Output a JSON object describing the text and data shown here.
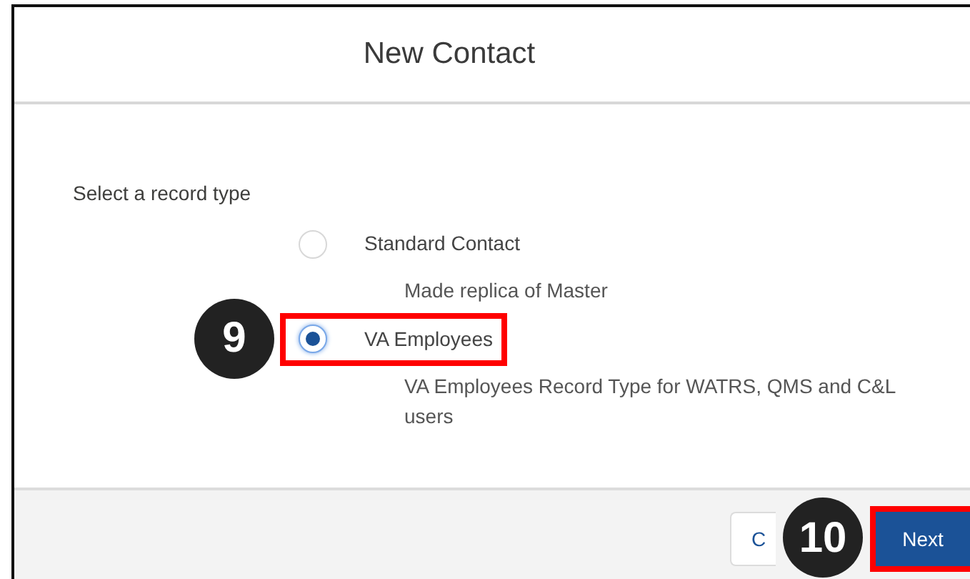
{
  "modal": {
    "title": "New Contact"
  },
  "prompt": "Select a record type",
  "options": [
    {
      "label": "Standard Contact",
      "description": "Made replica of Master",
      "selected": false,
      "highlighted": false
    },
    {
      "label": "VA Employees",
      "description": "VA Employees Record Type for WATRS, QMS and C&L users",
      "selected": true,
      "highlighted": true,
      "callout": "9"
    }
  ],
  "buttons": [
    {
      "label": "C",
      "kind": "neutral",
      "highlighted": false
    },
    {
      "label": "Next",
      "kind": "brand",
      "highlighted": true,
      "callout": "10"
    }
  ]
}
